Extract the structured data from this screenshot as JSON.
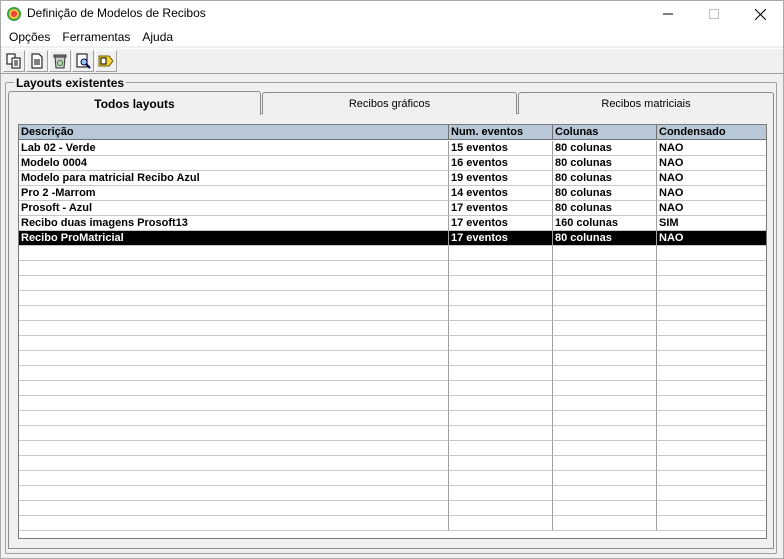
{
  "window": {
    "title": "Definição de Modelos de Recibos"
  },
  "menu": [
    "Opções",
    "Ferramentas",
    "Ajuda"
  ],
  "toolbar": {
    "icons": [
      "copy-icon",
      "document-icon",
      "recycle-icon",
      "search-icon",
      "export-icon"
    ]
  },
  "group": {
    "title": "Layouts existentes"
  },
  "tabs": [
    {
      "label": "Todos layouts",
      "active": true
    },
    {
      "label": "Recibos gráficos",
      "active": false
    },
    {
      "label": "Recibos matriciais",
      "active": false
    }
  ],
  "table": {
    "columns": [
      "Descrição",
      "Num. eventos",
      "Colunas",
      "Condensado"
    ],
    "rows": [
      [
        "Lab 02 - Verde",
        " 15 eventos",
        "80 colunas",
        "NAO"
      ],
      [
        "Modelo 0004",
        "16 eventos",
        "80 colunas",
        "NAO"
      ],
      [
        "Modelo para matricial Recibo Azul",
        " 19 eventos",
        "80 colunas",
        "NAO"
      ],
      [
        "Pro 2 -Marrom",
        " 14 eventos",
        "80 colunas",
        "NAO"
      ],
      [
        "Prosoft - Azul",
        " 17 eventos",
        "80 colunas",
        "NAO"
      ],
      [
        "Recibo duas imagens Prosoft13",
        " 17 eventos",
        "160 colunas",
        "SIM"
      ],
      [
        "Recibo ProMatricial",
        " 17 eventos",
        "80 colunas",
        "NAO"
      ]
    ],
    "selected_row": 6
  },
  "colors": {
    "header_bg": "#b8c8d8",
    "selected_bg": "#000000",
    "selected_fg": "#ffffff"
  }
}
